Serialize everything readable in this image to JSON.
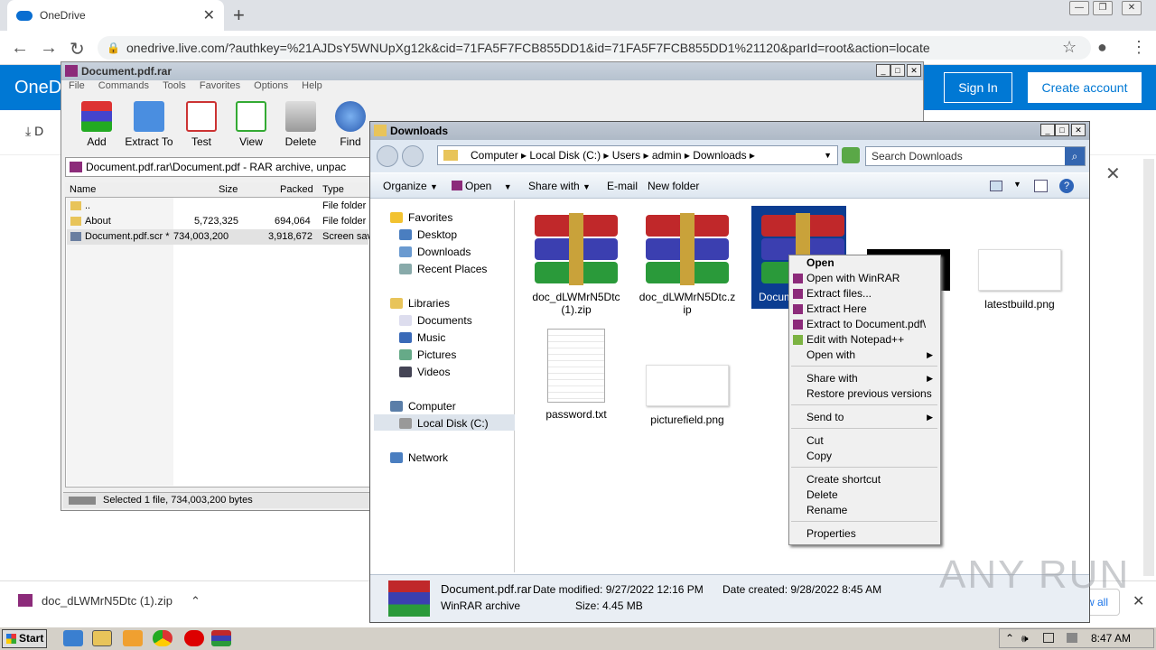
{
  "browser": {
    "tab_title": "OneDrive",
    "url": "onedrive.live.com/?authkey=%21AJDsY5WNUpXg12k&cid=71FA5F7FCB855DD1&id=71FA5F7FCB855DD1%21120&parId=root&action=locate"
  },
  "onedrive": {
    "logo": "OneD",
    "sign_in": "Sign In",
    "create_account": "Create account",
    "download_label": "D"
  },
  "download_shelf": {
    "file": "doc_dLWMrN5Dtc (1).zip",
    "show_all": "w all"
  },
  "winrar": {
    "title": "Document.pdf.rar",
    "menu": [
      "File",
      "Commands",
      "Tools",
      "Favorites",
      "Options",
      "Help"
    ],
    "toolbar": [
      "Add",
      "Extract To",
      "Test",
      "View",
      "Delete",
      "Find"
    ],
    "address": "Document.pdf.rar\\Document.pdf - RAR archive, unpac",
    "columns": [
      "Name",
      "Size",
      "Packed",
      "Type"
    ],
    "rows": [
      {
        "name": "..",
        "size": "",
        "packed": "",
        "type": "File folder"
      },
      {
        "name": "About",
        "size": "5,723,325",
        "packed": "694,064",
        "type": "File folder"
      },
      {
        "name": "Document.pdf.scr *",
        "size": "734,003,200",
        "packed": "3,918,672",
        "type": "Screen sav"
      }
    ],
    "status": "Selected 1 file, 734,003,200 bytes"
  },
  "explorer": {
    "title": "Downloads",
    "breadcrumb": [
      "Computer",
      "Local Disk (C:)",
      "Users",
      "admin",
      "Downloads"
    ],
    "search_placeholder": "Search Downloads",
    "commands": [
      "Organize",
      "Open",
      "Share with",
      "E-mail",
      "New folder"
    ],
    "nav": {
      "favorites": "Favorites",
      "favorites_items": [
        "Desktop",
        "Downloads",
        "Recent Places"
      ],
      "libraries": "Libraries",
      "libraries_items": [
        "Documents",
        "Music",
        "Pictures",
        "Videos"
      ],
      "computer": "Computer",
      "computer_items": [
        "Local Disk (C:)"
      ],
      "network": "Network"
    },
    "files": {
      "f1_line1": "doc_dLWMrN5Dtc",
      "f1_line2": "(1).zip",
      "f2_line1": "doc_dLWMrN5Dtc.z",
      "f2_line2": "ip",
      "f3": "Docum",
      "f5": "latestbuild.png",
      "f6": "password.txt",
      "f7": "picturefield.png"
    },
    "details": {
      "name": "Document.pdf.rar",
      "type": "WinRAR archive",
      "modified": "Date modified: 9/27/2022 12:16 PM",
      "size": "Size: 4.45 MB",
      "created": "Date created: 9/28/2022 8:45 AM"
    }
  },
  "context_menu": {
    "open": "Open",
    "open_winrar": "Open with WinRAR",
    "extract_files": "Extract files...",
    "extract_here": "Extract Here",
    "extract_to": "Extract to Document.pdf\\",
    "edit_notepad": "Edit with Notepad++",
    "open_with": "Open with",
    "share_with": "Share with",
    "restore": "Restore previous versions",
    "send_to": "Send to",
    "cut": "Cut",
    "copy": "Copy",
    "create_shortcut": "Create shortcut",
    "delete": "Delete",
    "rename": "Rename",
    "properties": "Properties"
  },
  "taskbar": {
    "start": "Start",
    "clock": "8:47 AM"
  },
  "watermark": "ANY RUN"
}
